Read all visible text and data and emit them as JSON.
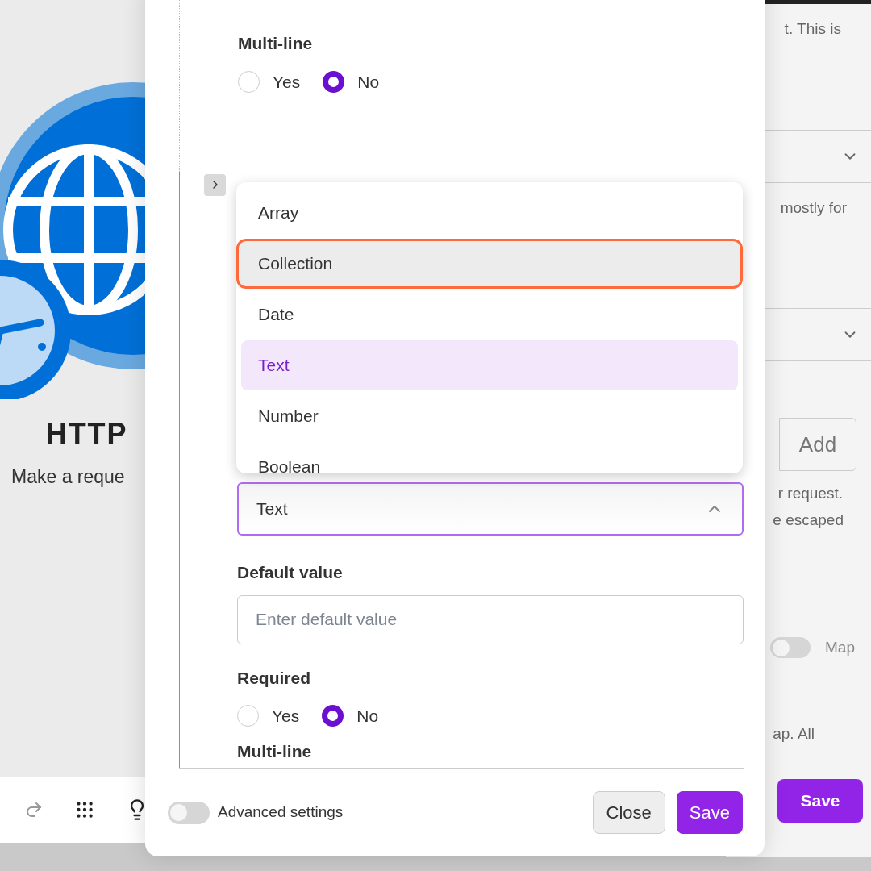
{
  "background_left": {
    "title": "HTTP",
    "subtitle": "Make a reque"
  },
  "background_right": {
    "line_1": "t. This is",
    "line_2": "mostly for",
    "add_button": "Add",
    "line_3": "r request.",
    "line_4": "e escaped",
    "map_toggle": {
      "label": "Map",
      "on": false
    },
    "line_5": "ap. All",
    "save_button": "Save"
  },
  "dialog": {
    "multi_line_top": {
      "label": "Multi-line",
      "options": [
        {
          "label": "Yes",
          "selected": false
        },
        {
          "label": "No",
          "selected": true
        }
      ]
    },
    "type_dropdown": {
      "items": [
        {
          "label": "Array",
          "selected": false,
          "focused": false
        },
        {
          "label": "Collection",
          "selected": false,
          "focused": true
        },
        {
          "label": "Date",
          "selected": false,
          "focused": false
        },
        {
          "label": "Text",
          "selected": true,
          "focused": false
        },
        {
          "label": "Number",
          "selected": false,
          "focused": false
        },
        {
          "label": "Boolean",
          "selected": false,
          "focused": false
        }
      ]
    },
    "type_select": {
      "value": "Text",
      "expanded": true
    },
    "default_value": {
      "label": "Default value",
      "placeholder": "Enter default value"
    },
    "required": {
      "label": "Required",
      "options": [
        {
          "label": "Yes",
          "selected": false
        },
        {
          "label": "No",
          "selected": true
        }
      ]
    },
    "multi_line_bottom": {
      "label": "Multi-line"
    },
    "advanced_settings": {
      "label": "Advanced settings",
      "on": false
    },
    "buttons": [
      {
        "label": "Close",
        "kind": "secondary"
      },
      {
        "label": "Save",
        "kind": "primary"
      }
    ]
  }
}
